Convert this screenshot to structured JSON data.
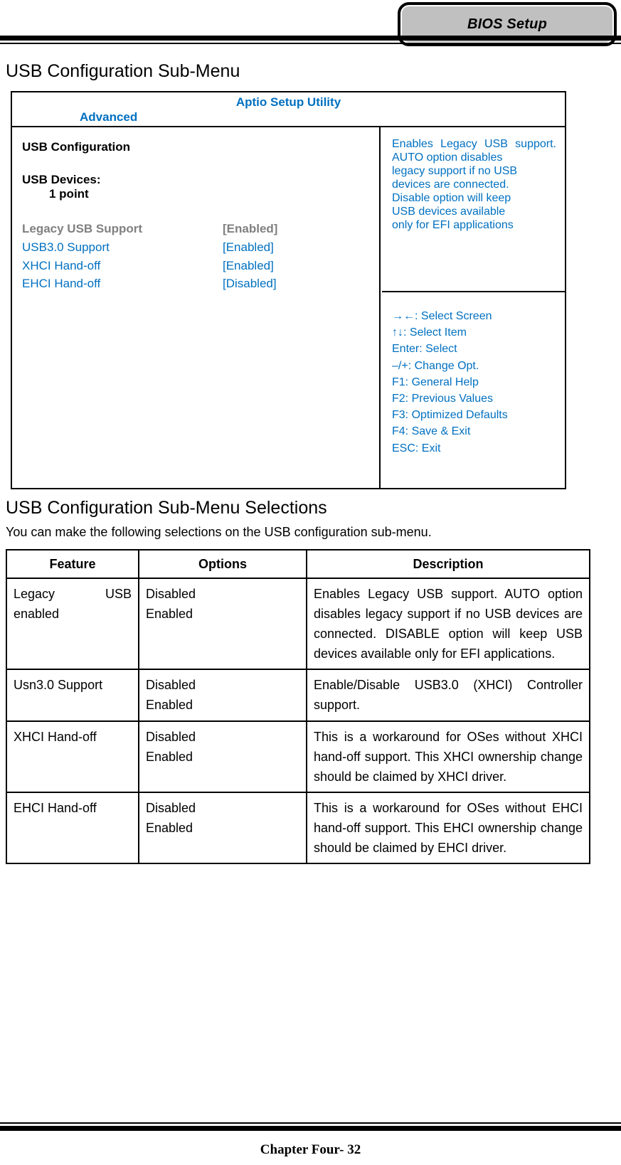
{
  "header": {
    "badge_label": "BIOS Setup"
  },
  "page": {
    "heading_1": "USB Configuration Sub-Menu",
    "heading_2": "USB Configuration Sub-Menu Selections",
    "intro": "You can make the following selections on the USB configuration sub-menu.",
    "footer": "Chapter Four- 32",
    "accent_blue": "#0070C0",
    "selected_gray": "#808080"
  },
  "bios": {
    "utility_title": "Aptio Setup Utility",
    "menu_tab": "Advanced",
    "section_title": "USB Configuration",
    "devices_label": "USB Devices:",
    "devices_value": "1 point",
    "options": [
      {
        "name": "Legacy USB Support",
        "value": "[Enabled]",
        "state": "selected"
      },
      {
        "name": "USB3.0 Support",
        "value": "[Enabled]",
        "state": "normal"
      },
      {
        "name": "XHCI Hand-off",
        "value": "[Enabled]",
        "state": "normal"
      },
      {
        "name": "EHCI Hand-off",
        "value": "[Disabled]",
        "state": "normal"
      }
    ],
    "help_lines": [
      "Enables Legacy USB support.",
      "AUTO option disables",
      "legacy support if no USB",
      "devices are connected.",
      "Disable option will keep",
      "USB devices available",
      "only for EFI applications"
    ],
    "key_lines": [
      "→←: Select Screen",
      "↑↓: Select Item",
      "Enter: Select",
      "–/+: Change Opt.",
      "F1: General Help",
      "F2: Previous Values",
      "F3: Optimized Defaults",
      "F4: Save & Exit",
      "ESC: Exit"
    ]
  },
  "selections_table": {
    "columns": [
      "Feature",
      "Options",
      "Description"
    ],
    "rows": [
      {
        "feature": "Legacy USB enabled",
        "options": [
          "Disabled",
          "Enabled"
        ],
        "description": "Enables Legacy USB support. AUTO option disables legacy support if no USB devices are connected. DISABLE option will keep USB devices available only",
        "description_last": "for EFI applications."
      },
      {
        "feature": "Usn3.0 Support",
        "options": [
          "Disabled",
          "Enabled"
        ],
        "description": "Enable/Disable USB3.0 (XHCI)",
        "description_last": "Controller support."
      },
      {
        "feature": "XHCI Hand-off",
        "options": [
          "Disabled",
          "Enabled"
        ],
        "description": "This is a workaround for OSes without XHCI hand-off support. This XHCI ownership change should be claimed by XHCI",
        "description_last": "driver."
      },
      {
        "feature": "EHCI Hand-off",
        "options": [
          "Disabled",
          "Enabled"
        ],
        "description": "This is a workaround for OSes without EHCI hand-off support. This EHCI ownership change should be claimed by EHCI",
        "description_last": "driver."
      }
    ]
  }
}
